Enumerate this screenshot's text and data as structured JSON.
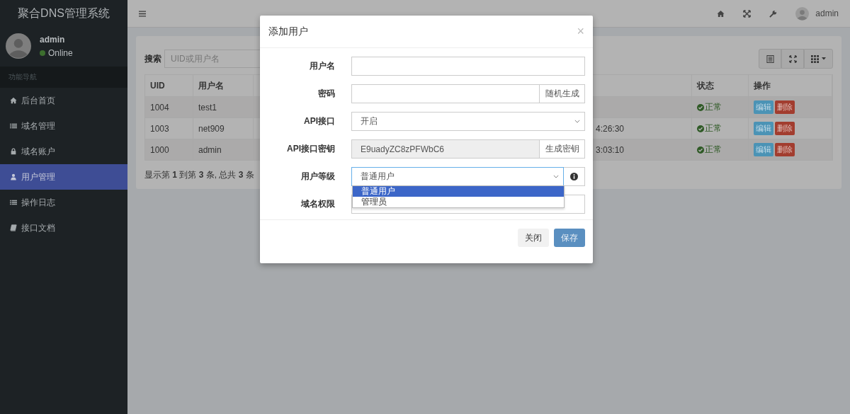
{
  "sidebar": {
    "brand": "聚合DNS管理系统",
    "user": {
      "name": "admin",
      "status": "Online",
      "online": true
    },
    "section_label": "功能导航",
    "items": [
      {
        "label": "后台首页",
        "kind": "home",
        "selected": false
      },
      {
        "label": "域名管理",
        "kind": "list",
        "selected": false
      },
      {
        "label": "域名账户",
        "kind": "lock",
        "selected": false
      },
      {
        "label": "用户管理",
        "kind": "user",
        "selected": true
      },
      {
        "label": "操作日志",
        "kind": "list",
        "selected": false
      },
      {
        "label": "接口文档",
        "kind": "book",
        "selected": false
      }
    ]
  },
  "topbar": {
    "user_name": "admin"
  },
  "search": {
    "label": "搜索",
    "placeholder": "UID或用户名"
  },
  "table": {
    "columns": [
      "UID",
      "用户名",
      "状态",
      "操作"
    ],
    "rows": [
      {
        "uid": "1004",
        "username": "test1",
        "status": "正常",
        "actions": [
          "编辑",
          "删除"
        ]
      },
      {
        "uid": "1003",
        "username": "net909",
        "time": "4:26:30",
        "status": "正常",
        "actions": [
          "编辑",
          "删除"
        ]
      },
      {
        "uid": "1000",
        "username": "admin",
        "time": "3:03:10",
        "status": "正常",
        "actions": [
          "编辑",
          "删除"
        ]
      }
    ]
  },
  "pagination": "显示第 **1** 到第 **3** 条, 总共 **3** 条",
  "modal": {
    "title": "添加用户",
    "close": "×",
    "fields": [
      {
        "label": "用户名",
        "kind": "text"
      },
      {
        "label": "密码",
        "kind": "addon",
        "button": "随机生成"
      },
      {
        "label": "API接口",
        "kind": "select",
        "value": "开启"
      },
      {
        "label": "API接口密钥",
        "kind": "readonly-addon",
        "value": "E9uadyZC8zPFWbC6",
        "button": "生成密钥"
      },
      {
        "label": "用户等级",
        "kind": "select-info",
        "value": "普通用户",
        "expanded": true,
        "options": [
          {
            "label": "普通用户",
            "selected": true
          },
          {
            "label": "管理员",
            "selected": false
          }
        ]
      },
      {
        "label": "域名权限",
        "kind": "text"
      }
    ],
    "buttons": [
      {
        "label": "关闭",
        "kind": "default"
      },
      {
        "label": "保存",
        "kind": "primary"
      }
    ]
  }
}
